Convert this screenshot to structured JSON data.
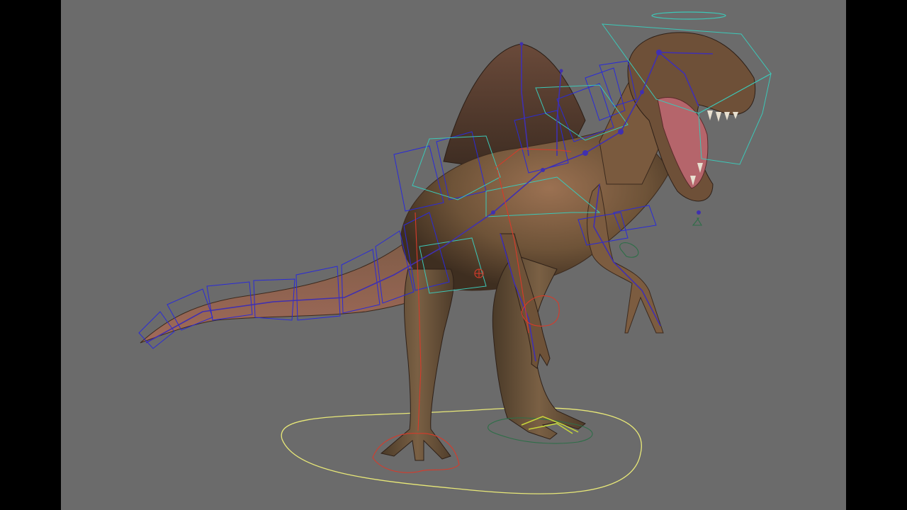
{
  "viewport": {
    "subject": "spinosaurus-rig",
    "background_color": "#6b6b6b",
    "letterbox_color": "#000000"
  },
  "colors": {
    "skin": "#7a5c3e",
    "skin_dark": "#4a3726",
    "belly": "#9b6a55",
    "mouth": "#b5656b",
    "ik_controls": "#2a2ad8",
    "fk_controls": "#3cc8b8",
    "joints": "#4030b0",
    "leg_controls": "#d83a2a",
    "ground_control": "#e8e878",
    "foot_ik": "#2e6e48"
  },
  "icons": {
    "main_ground_control": "ellipse-curve",
    "head_halo": "ellipse-curve",
    "foot_controls": "lobed-curve"
  }
}
